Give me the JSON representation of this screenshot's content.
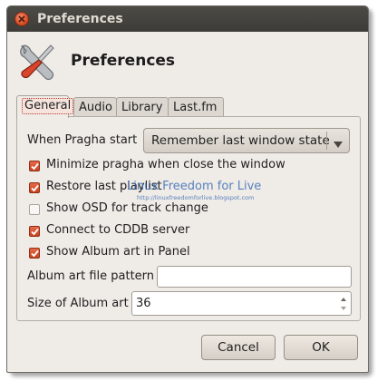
{
  "window": {
    "title": "Preferences",
    "icon": "close-icon"
  },
  "header": {
    "icon": "preferences-tools-icon",
    "title": "Preferences"
  },
  "tabs": [
    {
      "label": "General",
      "active": true
    },
    {
      "label": "Audio",
      "active": false
    },
    {
      "label": "Library",
      "active": false
    },
    {
      "label": "Last.fm",
      "active": false
    }
  ],
  "general": {
    "start_label": "When Pragha start",
    "start_value": "Remember last window state",
    "options": [
      {
        "label": "Minimize pragha when close the window",
        "checked": true
      },
      {
        "label": "Restore last playlist",
        "checked": true
      },
      {
        "label": "Show OSD for track change",
        "checked": false
      },
      {
        "label": "Connect to CDDB server",
        "checked": true
      },
      {
        "label": "Show Album art in Panel",
        "checked": true
      }
    ],
    "album_pattern_label": "Album art file pattern",
    "album_pattern_value": "",
    "album_size_label": "Size of Album art",
    "album_size_value": "36"
  },
  "watermark": {
    "line1": "Linux Freedom for Live",
    "line2": "http://linuxfreedomforlive.blogspot.com"
  },
  "buttons": {
    "cancel": "Cancel",
    "ok": "OK"
  },
  "colors": {
    "titlebar": "#3d3c38",
    "accent": "#d5471f",
    "window_bg": "#efebe7"
  }
}
